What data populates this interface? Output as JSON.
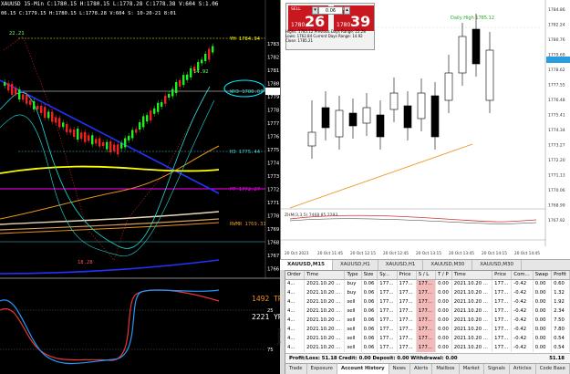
{
  "left_chart": {
    "title": "XAUUSD 15-Min C:1780.15 H:1780.15 L:1778.28 C:1778.38 V:604 S:1.06",
    "sub": "06.15  C:1779.15 H:1780.15 L:1778.28  V:604  S:    10-20-21  8:01",
    "hi_label": "22.21",
    "lo_label": "18.28",
    "last_label": "14.92",
    "levels": {
      "yh": "YH 1784.94",
      "wh3": "WH3 1780.07",
      "h3": "H3 1775.44",
      "pp": "PP 1772.27",
      "rwmr": "RWMR 1769.31"
    },
    "price_axis": [
      "1783",
      "1782",
      "1781",
      "1780",
      "1779",
      "1778",
      "1777",
      "1776",
      "1775",
      "1774",
      "1773",
      "1772",
      "1771",
      "1770",
      "1769",
      "1768",
      "1767",
      "1766"
    ],
    "osc_labels": {
      "top_value": "1492 TRA",
      "second_value": "2221 YR",
      "l25": "25",
      "l75": "75"
    }
  },
  "right_chart": {
    "symbol_label": "XAUUSD,M15",
    "daily_high": "Daily High 1785.12",
    "trade_panel": {
      "sell_label": "SELL",
      "buy_label": "BUY",
      "lot": "0.06",
      "sell_small": "1780",
      "sell_big": "26",
      "buy_small": "1780",
      "buy_big": "39"
    },
    "info_lines": [
      "Highs: 1785.12   Previous Days Range: 22.28",
      "Lows: 1762.84   Current Days Range: 14.92",
      "Close: 1785.21"
    ],
    "indicator_label": "ZHM(3,3,5) 7468 85.2293",
    "price_axis": [
      "1784.86",
      "1782.24",
      "1780.76",
      "1779.69",
      "1778.62",
      "1777.55",
      "1776.48",
      "1775.41",
      "1774.34",
      "1773.27",
      "1772.20",
      "1771.13",
      "1770.06",
      "1768.99",
      "1767.92"
    ],
    "time_axis": [
      "20 Oct 2021",
      "20 Oct 11:45",
      "20 Oct 12:15",
      "20 Oct 12:45",
      "20 Oct 13:15",
      "20 Oct 13:45",
      "20 Oct 14:15",
      "20 Oct 14:45"
    ],
    "tabs": [
      "XAUUSD,M15",
      "XAUUSD,H1",
      "XAUUSD,H1",
      "XAUUSD,M30",
      "XAUUSD,M30"
    ]
  },
  "terminal": {
    "columns": [
      "Order",
      "Time",
      "Type",
      "Size",
      "Sy...",
      "Price",
      "S / L",
      "T / P",
      "Time",
      "Price",
      "Com...",
      "Swap",
      "Profit"
    ],
    "rows": [
      [
        "4...",
        "2021.10.20 ...",
        "buy",
        "0.06",
        "177...",
        "177...",
        "177...",
        "0.00",
        "2021.10.20 ...",
        "177...",
        "-0.42",
        "0.00",
        "0.60"
      ],
      [
        "4...",
        "2021.10.20 ...",
        "buy",
        "0.06",
        "177...",
        "177...",
        "177...",
        "0.00",
        "2021.10.20 ...",
        "177...",
        "-0.42",
        "0.00",
        "1.32"
      ],
      [
        "4...",
        "2021.10.20 ...",
        "sell",
        "0.06",
        "177...",
        "177...",
        "177...",
        "0.00",
        "2021.10.20 ...",
        "177...",
        "-0.42",
        "0.00",
        "1.92"
      ],
      [
        "4...",
        "2021.10.20 ...",
        "sell",
        "0.06",
        "177...",
        "177...",
        "177...",
        "0.00",
        "2021.10.20 ...",
        "177...",
        "-0.42",
        "0.00",
        "2.34"
      ],
      [
        "4...",
        "2021.10.20 ...",
        "sell",
        "0.06",
        "177...",
        "177...",
        "177...",
        "0.00",
        "2021.10.20 ...",
        "177...",
        "-0.42",
        "0.00",
        "7.50"
      ],
      [
        "4...",
        "2021.10.20 ...",
        "sell",
        "0.06",
        "177...",
        "177...",
        "177...",
        "0.00",
        "2021.10.20 ...",
        "177...",
        "-0.42",
        "0.00",
        "7.80"
      ],
      [
        "4...",
        "2021.10.20 ...",
        "sell",
        "0.06",
        "177...",
        "177...",
        "177...",
        "0.00",
        "2021.10.20 ...",
        "177...",
        "-0.42",
        "0.00",
        "0.54"
      ],
      [
        "4...",
        "2021.10.20 ...",
        "sell",
        "0.06",
        "177...",
        "177...",
        "177...",
        "0.00",
        "2021.10.20 ...",
        "177...",
        "-0.42",
        "0.00",
        "0.54"
      ]
    ],
    "summary": "Profit/Loss: 51.18  Credit: 0.00  Deposit: 0.00  Withdrawal: 0.00",
    "summary_total": "51.18",
    "side_label": "Terminal",
    "tabs": [
      "Trade",
      "Exposure",
      "Account History",
      "News",
      "Alerts",
      "Mailbox",
      "Market",
      "Signals",
      "Articles",
      "Code Base"
    ]
  }
}
